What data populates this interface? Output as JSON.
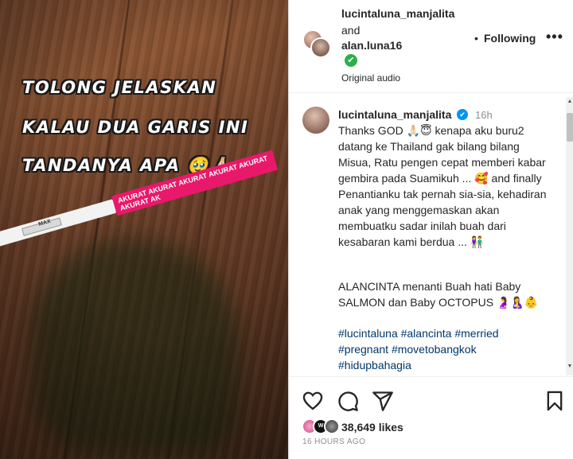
{
  "media": {
    "overlay_lines": [
      "TOLONG JELASKAN",
      "KALAU DUA GARIS INI",
      "TANDANYA APA 🥹🙏🏻"
    ],
    "strip_text": "AKURAT AKURAT AKURAT AKURAT AKURAT AKURAT AK",
    "strip_label": "MAX"
  },
  "header": {
    "user1": "lucintaluna_manjalita",
    "and_text": "and",
    "user2": "alan.luna16",
    "dot": "•",
    "following_label": "Following",
    "more": "•••",
    "audio": "Original audio",
    "verified_mark": "✔"
  },
  "caption": {
    "username": "lucintaluna_manjalita",
    "verified_mark": "✔",
    "time": "16h",
    "paragraph1": "Thanks GOD 🙏🏻😇 kenapa aku buru2 datang ke Thailand gak bilang bilang Misua, Ratu pengen cepat memberi kabar gembira pada Suamikuh ... 🥰 and finally Penantianku tak pernah sia-sia, kehadiran anak yang menggemaskan akan membuatku sadar inilah buah dari kesabaran kami berdua ... 👫",
    "paragraph2": "ALANCINTA menanti Buah hati Baby SALMON dan Baby OCTOPUS 🤰🤱👶",
    "hashtags": "#lucintaluna #alancinta #merried #pregnant #movetobangkok #hidupbahagia"
  },
  "scrollbar": {
    "up": "▲",
    "down": "▼"
  },
  "actions": {
    "liker2_text": "W",
    "likes": "38,649 likes",
    "age": "16 HOURS AGO"
  }
}
